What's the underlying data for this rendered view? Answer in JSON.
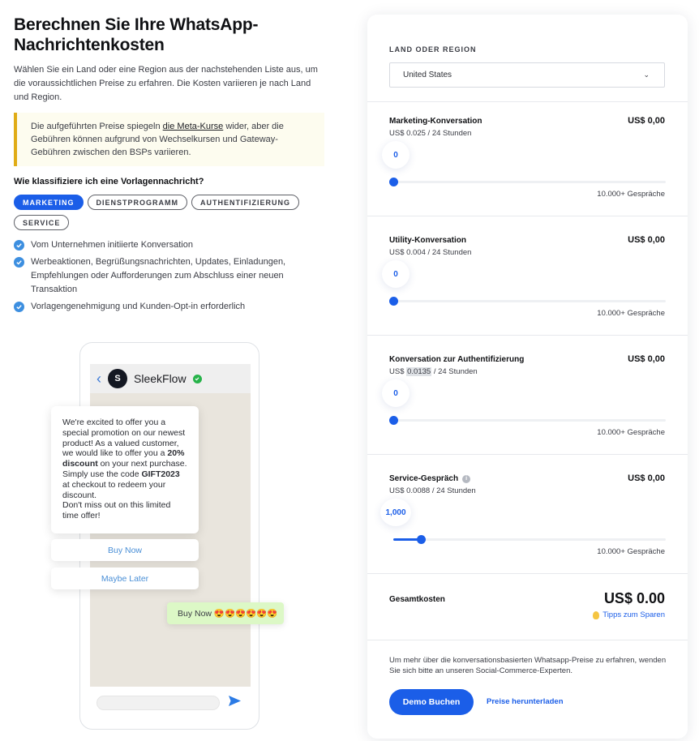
{
  "left": {
    "title": "Berechnen Sie Ihre WhatsApp-Nachrichtenkosten",
    "intro": "Wählen Sie ein Land oder eine Region aus der nachstehenden Liste aus, um die voraussichtlichen Preise zu erfahren. Die Kosten variieren je nach Land und Region.",
    "notice_before": "Die aufgeführten Preise spiegeln ",
    "notice_link": "die Meta-Kurse",
    "notice_after": " wider, aber die Gebühren können aufgrund von Wechselkursen und Gateway-Gebühren zwischen den BSPs variieren.",
    "question": "Wie klassifiziere ich eine Vorlagennachricht?",
    "tabs": [
      {
        "label": "MARKETING",
        "active": true
      },
      {
        "label": "DIENSTPROGRAMM",
        "active": false
      },
      {
        "label": "AUTHENTIFIZIERUNG",
        "active": false
      },
      {
        "label": "SERVICE",
        "active": false
      }
    ],
    "checks": [
      "Vom Unternehmen initiierte Konversation",
      "Werbeaktionen, Begrüßungsnachrichten, Updates, Einladungen, Empfehlungen oder Aufforderungen zum Abschluss einer neuen Transaktion",
      "Vorlagengenehmigung und Kunden-Opt-in erforderlich"
    ]
  },
  "phone": {
    "logo_letter": "S",
    "brand": "SleekFlow",
    "message": {
      "p1": "We're excited to offer you a special promotion on our newest product! As a valued customer, we would like to offer you a ",
      "b1": "20% discount",
      "p2": " on your next purchase. Simply use the code ",
      "b2": "GIFT2023",
      "p3": " at checkout to redeem your discount.",
      "p4": "Don't miss out on this limited time offer!"
    },
    "quick_reply_1": "Buy Now",
    "quick_reply_2": "Maybe Later",
    "reply": "Buy Now 😍😍😍😍😍😍"
  },
  "card": {
    "region_label": "LAND ODER REGION",
    "region_value": "United States",
    "sections": [
      {
        "title": "Marketing-Konversation",
        "price": "US$ 0,00",
        "rate_prefix": "US$ ",
        "rate_value": "0.025",
        "rate_suffix": " / 24 Stunden",
        "value": "0",
        "value_num": 0,
        "max": "10.000+ Gespräche"
      },
      {
        "title": "Utility-Konversation",
        "price": "US$ 0,00",
        "rate_prefix": "US$ ",
        "rate_value": "0.004",
        "rate_suffix": " / 24 Stunden",
        "value": "0",
        "value_num": 0,
        "max": "10.000+ Gespräche"
      },
      {
        "title": "Konversation zur Authentifizierung",
        "price": "US$ 0,00",
        "rate_prefix": "US$ ",
        "rate_value": "0.0135",
        "rate_suffix": " / 24 Stunden",
        "value": "0",
        "value_num": 0,
        "max": "10.000+ Gespräche"
      },
      {
        "title": "Service-Gespräch",
        "price": "US$ 0,00",
        "rate_prefix": "US$ ",
        "rate_value": "0.0088",
        "rate_suffix": " / 24 Stunden",
        "value": "1,000",
        "value_num": 1000,
        "max": "10.000+ Gespräche"
      }
    ],
    "total_label": "Gesamtkosten",
    "total_value": "US$ 0.00",
    "tips": "Tipps zum Sparen",
    "footer_text": "Um mehr über die konversationsbasierten Whatsapp-Preise zu erfahren, wenden Sie sich bitte an unseren Social-Commerce-Experten.",
    "demo_button": "Demo Buchen",
    "download_link": "Preise herunterladen"
  },
  "colors": {
    "accent": "#1b5ee8",
    "notice_border": "#e0ac16",
    "check": "#3d8fe0",
    "reply_bubble": "#dcf8c6"
  }
}
